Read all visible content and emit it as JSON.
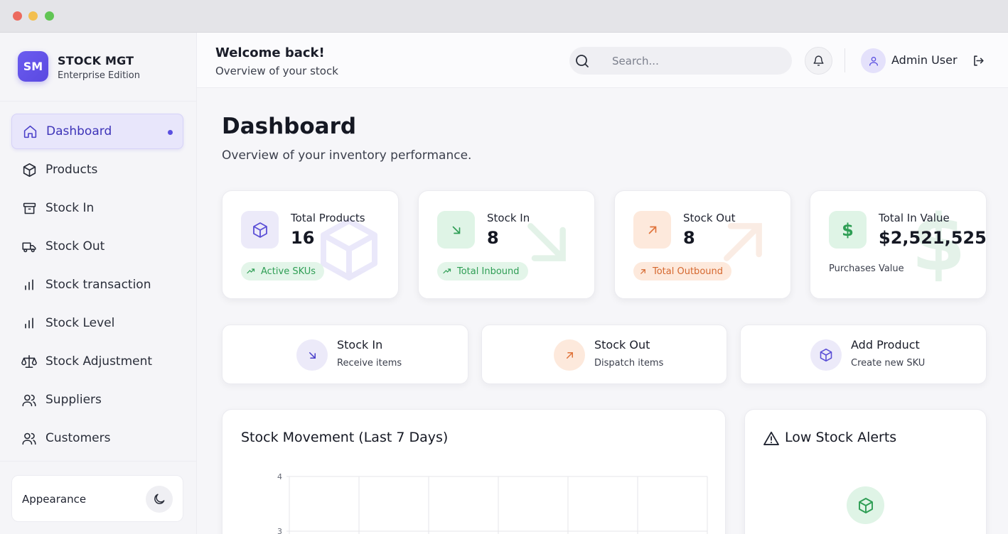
{
  "brand": {
    "initials": "SM",
    "title": "STOCK MGT",
    "subtitle": "Enterprise Edition"
  },
  "sidebar": {
    "items": [
      {
        "label": "Dashboard",
        "icon": "home-icon",
        "active": true
      },
      {
        "label": "Products",
        "icon": "box-icon"
      },
      {
        "label": "Stock In",
        "icon": "archive-icon"
      },
      {
        "label": "Stock Out",
        "icon": "truck-icon"
      },
      {
        "label": "Stock transaction",
        "icon": "bar-chart-icon"
      },
      {
        "label": "Stock Level",
        "icon": "bar-chart-icon"
      },
      {
        "label": "Stock Adjustment",
        "icon": "scale-icon"
      },
      {
        "label": "Suppliers",
        "icon": "users-icon"
      },
      {
        "label": "Customers",
        "icon": "users-icon"
      }
    ],
    "appearance_label": "Appearance"
  },
  "header": {
    "welcome": "Welcome back!",
    "subtitle": "Overview of your stock",
    "search_placeholder": "Search...",
    "user_name": "Admin User"
  },
  "main": {
    "title": "Dashboard",
    "subtitle": "Overview of your inventory performance."
  },
  "stats": [
    {
      "label": "Total Products",
      "value": "16",
      "tag": "Active SKUs",
      "color": "#5b4fd6"
    },
    {
      "label": "Stock In",
      "value": "8",
      "tag": "Total Inbound",
      "color": "#2f9e55"
    },
    {
      "label": "Stock Out",
      "value": "8",
      "tag": "Total Outbound",
      "color": "#e0733a"
    },
    {
      "label": "Total In Value",
      "value": "$2,521,525",
      "tag": "Purchases Value",
      "color": "#2f9e55"
    }
  ],
  "quick_actions": [
    {
      "title": "Stock In",
      "subtitle": "Receive items"
    },
    {
      "title": "Stock Out",
      "subtitle": "Dispatch items"
    },
    {
      "title": "Add Product",
      "subtitle": "Create new SKU"
    }
  ],
  "chart": {
    "title": "Stock Movement (Last 7 Days)"
  },
  "chart_data": {
    "type": "line",
    "title": "Stock Movement (Last 7 Days)",
    "y_ticks_visible": [
      4,
      3
    ],
    "grid": true
  },
  "alerts": {
    "title": "Low Stock Alerts"
  }
}
